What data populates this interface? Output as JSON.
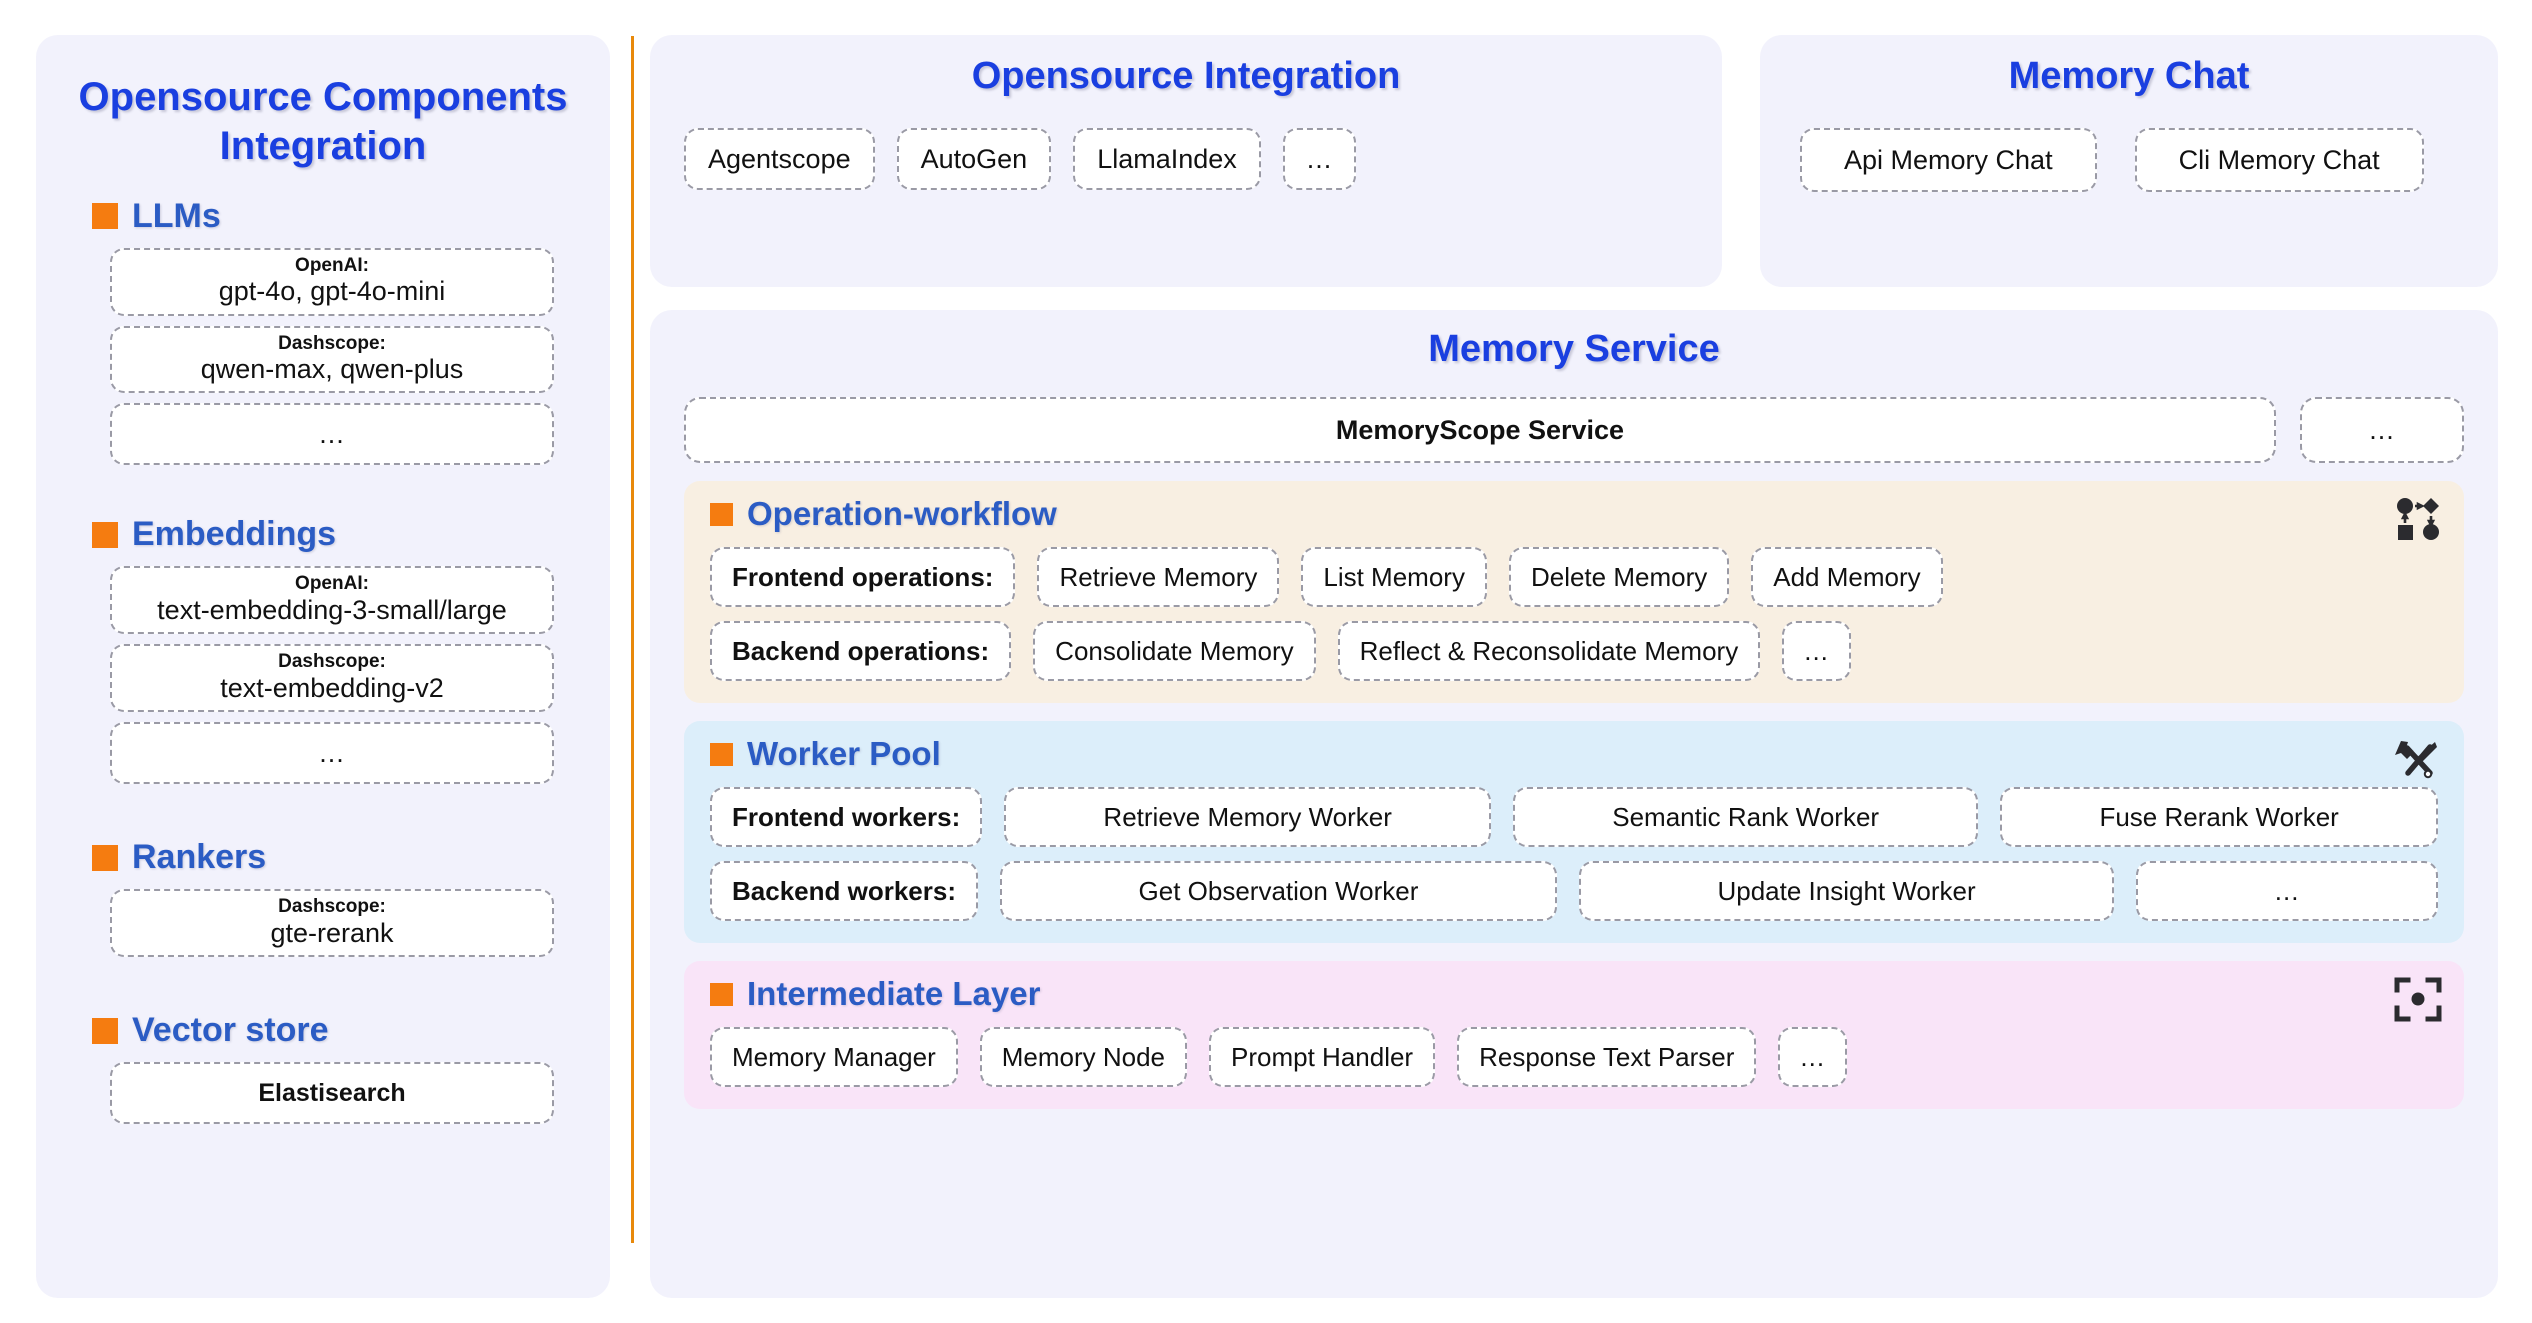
{
  "colors": {
    "title_blue": "#1A3FE0",
    "heading_blue": "#2B5CC4",
    "accent_orange": "#F57C10",
    "panel_bg": "#F2F2FC",
    "workflow_bg": "#F8EFE2",
    "worker_bg": "#DCEEFA",
    "intermediate_bg": "#F9E4F8",
    "divider": "#E8890B"
  },
  "left_panel": {
    "title": "Opensource Components Integration",
    "groups": [
      {
        "label": "LLMs",
        "icon": "orange-square-bullet-icon",
        "items": [
          {
            "vendor": "OpenAI:",
            "model": "gpt-4o, gpt-4o-mini"
          },
          {
            "vendor": "Dashscope:",
            "model": "qwen-max, qwen-plus"
          },
          {
            "vendor": "",
            "model": "..."
          }
        ]
      },
      {
        "label": "Embeddings",
        "icon": "orange-square-bullet-icon",
        "items": [
          {
            "vendor": "OpenAI:",
            "model": "text-embedding-3-small/large"
          },
          {
            "vendor": "Dashscope:",
            "model": "text-embedding-v2"
          },
          {
            "vendor": "",
            "model": "..."
          }
        ]
      },
      {
        "label": "Rankers",
        "icon": "orange-square-bullet-icon",
        "items": [
          {
            "vendor": "Dashscope:",
            "model": "gte-rerank"
          }
        ]
      },
      {
        "label": "Vector store",
        "icon": "orange-square-bullet-icon",
        "items": [
          {
            "vendor": "",
            "model": "Elastisearch",
            "bold": true
          }
        ]
      }
    ]
  },
  "integration_panel": {
    "title": "Opensource Integration",
    "chips": [
      "Agentscope",
      "AutoGen",
      "LlamaIndex",
      "..."
    ]
  },
  "memory_chat_panel": {
    "title": "Memory Chat",
    "chips": [
      "Api Memory Chat",
      "Cli Memory Chat"
    ]
  },
  "memory_service": {
    "title": "Memory Service",
    "service_box": "MemoryScope Service",
    "service_more": "...",
    "sections": [
      {
        "title": "Operation-workflow",
        "icon": "workflow-diagram-icon",
        "bullet_icon": "orange-square-bullet-icon",
        "rows": [
          {
            "lead": "Frontend operations:",
            "items": [
              "Retrieve Memory",
              "List Memory",
              "Delete Memory",
              "Add Memory"
            ]
          },
          {
            "lead": "Backend operations:",
            "items": [
              "Consolidate Memory",
              "Reflect & Reconsolidate Memory",
              "..."
            ]
          }
        ]
      },
      {
        "title": "Worker Pool",
        "icon": "tools-icon",
        "bullet_icon": "orange-square-bullet-icon",
        "rows": [
          {
            "lead": "Frontend workers:",
            "items": [
              "Retrieve Memory Worker",
              "Semantic Rank Worker",
              "Fuse Rerank Worker"
            ]
          },
          {
            "lead": "Backend workers:",
            "items": [
              "Get Observation Worker",
              "Update Insight Worker",
              "..."
            ]
          }
        ]
      },
      {
        "title": "Intermediate Layer",
        "icon": "focus-target-icon",
        "bullet_icon": "orange-square-bullet-icon",
        "rows": [
          {
            "lead": "",
            "items": [
              "Memory Manager",
              "Memory Node",
              "Prompt Handler",
              "Response Text Parser",
              "..."
            ]
          }
        ]
      }
    ]
  }
}
